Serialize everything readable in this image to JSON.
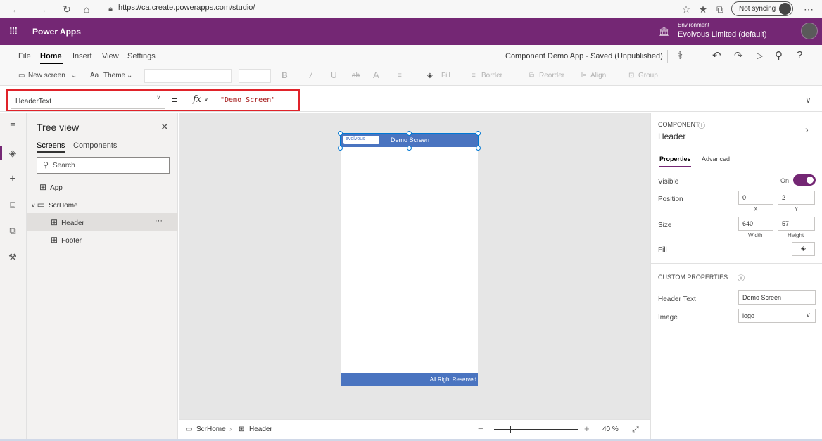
{
  "browser": {
    "url": "https://ca.create.powerapps.com/studio/",
    "sync_label": "Not syncing"
  },
  "appbar": {
    "title": "Power Apps",
    "env_label": "Environment",
    "env_name": "Evolvous Limited (default)"
  },
  "menu": {
    "items": [
      "File",
      "Home",
      "Insert",
      "View",
      "Settings"
    ],
    "active": "Home",
    "saved_status": "Component Demo App - Saved (Unpublished)"
  },
  "toolbar": {
    "new_screen": "New screen",
    "theme": "Theme",
    "fill": "Fill",
    "border": "Border",
    "reorder": "Reorder",
    "align": "Align",
    "group": "Group"
  },
  "formula": {
    "property": "HeaderText",
    "fx": "fx",
    "value": "\"Demo Screen\""
  },
  "tree": {
    "title": "Tree view",
    "tab_screens": "Screens",
    "tab_components": "Components",
    "search_placeholder": "Search",
    "nodes": {
      "app": "App",
      "screen": "ScrHome",
      "header": "Header",
      "footer": "Footer"
    },
    "more": "···"
  },
  "canvas": {
    "logo_text": "evolvous",
    "header_text": "Demo Screen",
    "footer_text": "All Right Reserved"
  },
  "status": {
    "screen": "ScrHome",
    "control": "Header",
    "minus": "−",
    "plus": "+",
    "zoom": "40 %"
  },
  "props": {
    "component_label": "COMPONENT",
    "component_name": "Header",
    "tab_properties": "Properties",
    "tab_advanced": "Advanced",
    "visible_label": "Visible",
    "visible_state": "On",
    "position_label": "Position",
    "pos_x": "0",
    "pos_y": "2",
    "x_label": "X",
    "y_label": "Y",
    "size_label": "Size",
    "width": "640",
    "height": "57",
    "width_label": "Width",
    "height_label": "Height",
    "fill_label": "Fill",
    "custom_label": "CUSTOM PROPERTIES",
    "header_text_label": "Header Text",
    "header_text_value": "Demo Screen",
    "image_label": "Image",
    "image_value": "logo"
  },
  "colors": {
    "brand": "#742774",
    "header_fill": "#4a74c0",
    "highlight": "#e0232a"
  }
}
